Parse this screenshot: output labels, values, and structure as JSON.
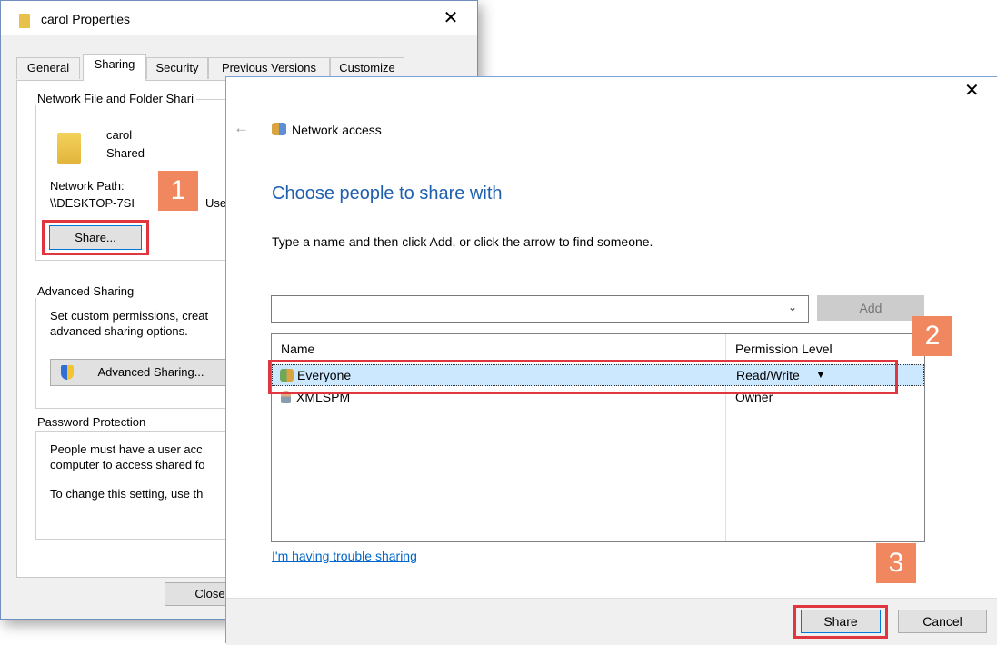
{
  "properties_window": {
    "title": "carol Properties",
    "close_glyph": "✕",
    "tabs": [
      "General",
      "Sharing",
      "Security",
      "Previous Versions",
      "Customize"
    ],
    "network_sharing": {
      "group_title": "Network File and Folder Shari",
      "folder_name": "carol",
      "folder_status": "Shared",
      "network_path_label": "Network Path:",
      "network_path_value": "\\\\DESKTOP-7SI",
      "network_path_tail": "Use",
      "share_button": "Share..."
    },
    "advanced_sharing": {
      "group_title": "Advanced Sharing",
      "description_line1": "Set custom permissions, creat",
      "description_line2": "advanced sharing options.",
      "button": "Advanced Sharing..."
    },
    "password_protection": {
      "group_title": "Password Protection",
      "line1": "People must have a user acc",
      "line2": "computer to access shared fo",
      "line3": "To change this setting, use th"
    },
    "close_button": "Close"
  },
  "dialog": {
    "close_glyph": "✕",
    "back_glyph": "←",
    "header": "Network access",
    "heading": "Choose people to share with",
    "instruction": "Type a name and then click Add, or click the arrow to find someone.",
    "name_input_value": "",
    "add_button": "Add",
    "columns": {
      "name": "Name",
      "permission": "Permission Level"
    },
    "rows": [
      {
        "name": "Everyone",
        "permission": "Read/Write",
        "dropdown": "▼",
        "selected": true
      },
      {
        "name": "XMLSPM",
        "permission": "Owner",
        "selected": false
      }
    ],
    "trouble_link": "I'm having trouble sharing",
    "share_button": "Share",
    "cancel_button": "Cancel"
  },
  "callouts": [
    "1",
    "2",
    "3"
  ],
  "colors": {
    "accent_blue": "#1e5fae",
    "callout": "#f0875f",
    "highlight_red": "#e0363f",
    "selection": "#cce8ff"
  }
}
